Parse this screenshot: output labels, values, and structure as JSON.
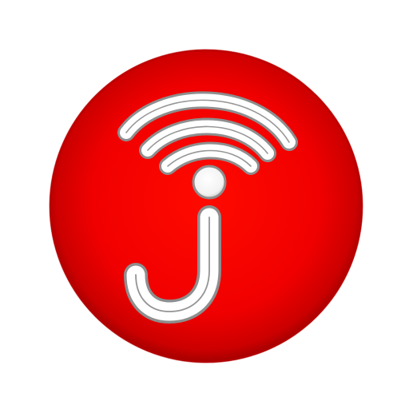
{
  "icon": {
    "name": "app-launcher-icon",
    "glyph": "j-wifi-logo-icon",
    "colors": {
      "disc_center": "#ff0a00",
      "disc_mid": "#e60000",
      "disc_edge": "#a30000",
      "glyph_fill": "#ffffff",
      "glyph_outline": "#8e8e8e",
      "glyph_inner_line": "#5a5a5a"
    }
  }
}
